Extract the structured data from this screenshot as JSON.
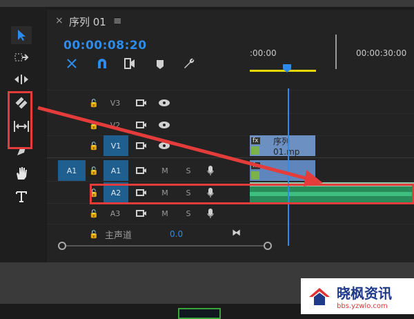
{
  "tab": {
    "close": "×",
    "title": "序列 01",
    "menu": "≡"
  },
  "timecode": "00:00:08:20",
  "ruler": {
    "label_start": ":00:00",
    "label_end": "00:00:30:00"
  },
  "tracks": {
    "v3": {
      "name": "V3"
    },
    "v2": {
      "name": "V2"
    },
    "v1": {
      "name": "V1",
      "source": "V1"
    },
    "a1": {
      "name": "A1",
      "source": "A1",
      "m": "M",
      "s": "S"
    },
    "a2": {
      "name": "A2",
      "m": "M",
      "s": "S"
    },
    "a3": {
      "name": "A3",
      "m": "M",
      "s": "S"
    },
    "master": {
      "name": "主声道",
      "value": "0.0"
    }
  },
  "clip": {
    "fx": "fx",
    "title": "序列 01.mp"
  },
  "watermark": {
    "title": "晓枫资讯",
    "url": "bbs.yzwlo.com"
  },
  "colors": {
    "accent": "#2d8ceb",
    "annotation": "#e43b3b",
    "audio": "#2a8b5a",
    "video": "#6d90c2"
  },
  "icons": [
    "selection-arrow-icon",
    "track-select-icon",
    "ripple-edit-icon",
    "razor-icon",
    "slip-icon",
    "pen-icon",
    "hand-icon",
    "text-tool-icon",
    "snap-icon",
    "linked-icon",
    "marker-icon",
    "wrench-icon",
    "lock-icon",
    "camera-icon",
    "eye-icon",
    "mic-icon",
    "playhead-icon"
  ]
}
